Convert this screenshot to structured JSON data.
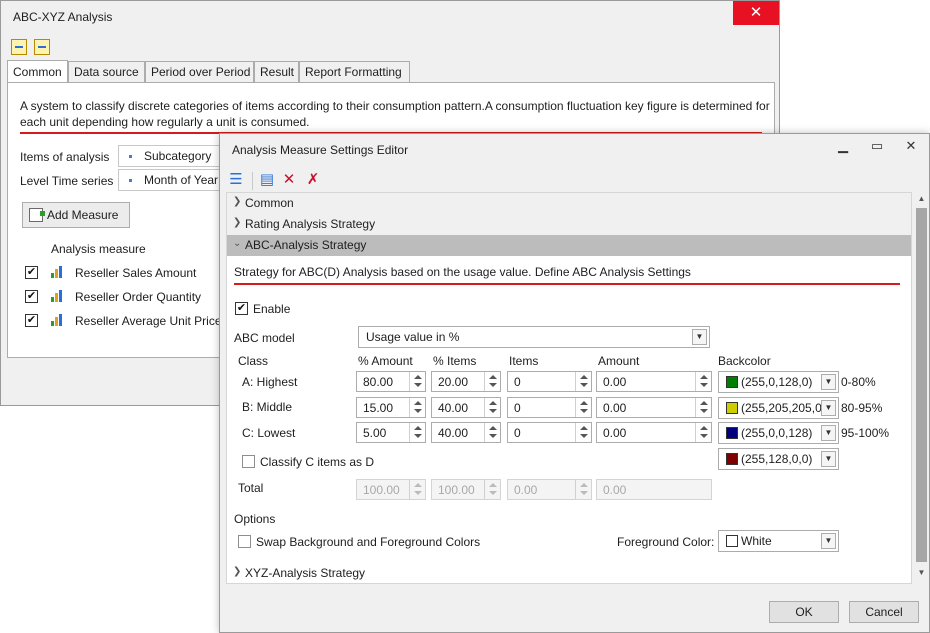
{
  "back_window": {
    "title": "ABC-XYZ Analysis",
    "close_glyph": "✕",
    "tabs": [
      {
        "label": "Common"
      },
      {
        "label": "Data source"
      },
      {
        "label": "Period over Period"
      },
      {
        "label": "Result"
      },
      {
        "label": "Report Formatting"
      }
    ],
    "description": "A system to classify discrete categories of items according to their consumption pattern.A consumption fluctuation key figure is determined for each unit depending how regularly a unit is consumed.",
    "items_of_analysis_label": "Items of analysis",
    "items_of_analysis_value": "Subcategory",
    "level_time_series_label": "Level Time series",
    "level_time_series_value": "Month of Year",
    "add_measure_label": "Add Measure",
    "analysis_measure_header": "Analysis measure",
    "measures": [
      {
        "label": "Reseller Sales Amount",
        "checked": true
      },
      {
        "label": "Reseller Order Quantity",
        "checked": true
      },
      {
        "label": "Reseller Average Unit Price",
        "checked": true
      }
    ]
  },
  "editor": {
    "title": "Analysis Measure Settings Editor",
    "sections": {
      "common": "Common",
      "rating": "Rating Analysis Strategy",
      "abc": "ABC-Analysis Strategy",
      "xyz": "XYZ-Analysis Strategy"
    },
    "abc_description": "Strategy for ABC(D) Analysis based on the usage value. Define ABC Analysis Settings",
    "enable_label": "Enable",
    "abc_model_label": "ABC model",
    "abc_model_value": "Usage value in %",
    "columns": {
      "class": "Class",
      "pct_amount": "% Amount",
      "pct_items": "% Items",
      "items": "Items",
      "amount": "Amount",
      "backcolor": "Backcolor"
    },
    "rows": [
      {
        "class": "A: Highest",
        "pct_amount": "80.00",
        "pct_items": "20.00",
        "items": "0",
        "amount": "0.00",
        "backcolor": "(255,0,128,0)",
        "swatch": "#008000",
        "range": "0-80%"
      },
      {
        "class": "B: Middle",
        "pct_amount": "15.00",
        "pct_items": "40.00",
        "items": "0",
        "amount": "0.00",
        "backcolor": "(255,205,205,0)",
        "swatch": "#cdcd00",
        "range": "80-95%"
      },
      {
        "class": "C: Lowest",
        "pct_amount": "5.00",
        "pct_items": "40.00",
        "items": "0",
        "amount": "0.00",
        "backcolor": "(255,0,0,128)",
        "swatch": "#000080",
        "range": "95-100%"
      }
    ],
    "classify_c_label": "Classify C items as D",
    "d_backcolor": "(255,128,0,0)",
    "d_swatch": "#800000",
    "total_label": "Total",
    "totals": {
      "pct_amount": "100.00",
      "pct_items": "100.00",
      "items": "0.00",
      "amount": "0.00"
    },
    "options_label": "Options",
    "swap_label": "Swap Background and Foreground Colors",
    "foreground_label": "Foreground Color:",
    "foreground_value": "White",
    "ok_label": "OK",
    "cancel_label": "Cancel"
  }
}
